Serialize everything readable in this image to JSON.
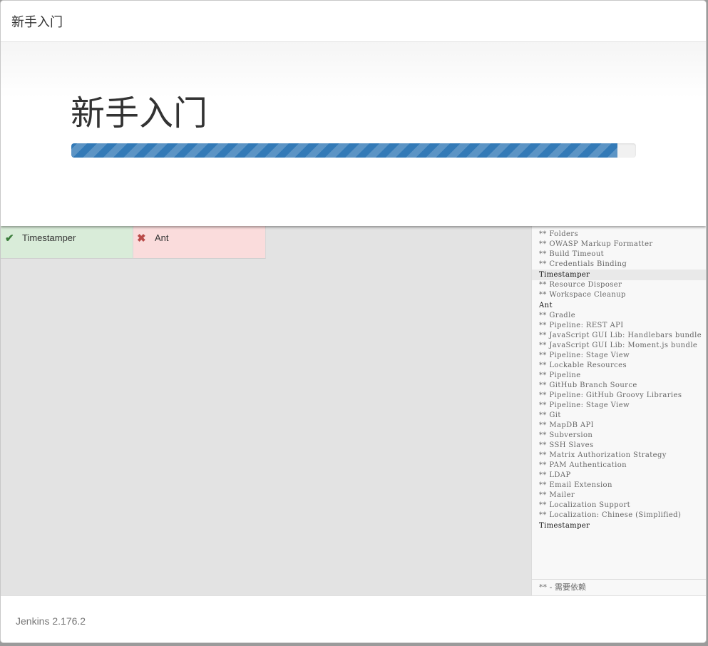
{
  "header": {
    "title": "新手入门"
  },
  "jumbotron": {
    "title": "新手入门",
    "progress_percent": 96.7,
    "progress_color": "#337ab7"
  },
  "plugins": [
    {
      "name": "Timestamper",
      "status": "success",
      "icon": "check-icon"
    },
    {
      "name": "Ant",
      "status": "failed",
      "icon": "cross-icon"
    }
  ],
  "log": {
    "lines": [
      {
        "text": "** Folders",
        "type": "dep"
      },
      {
        "text": "** OWASP Markup Formatter",
        "type": "dep"
      },
      {
        "text": "** Build Timeout",
        "type": "dep"
      },
      {
        "text": "** Credentials Binding",
        "type": "dep"
      },
      {
        "text": "Timestamper",
        "type": "header",
        "highlight": true
      },
      {
        "text": "** Resource Disposer",
        "type": "dep"
      },
      {
        "text": "** Workspace Cleanup",
        "type": "dep"
      },
      {
        "text": "Ant",
        "type": "header"
      },
      {
        "text": "** Gradle",
        "type": "dep"
      },
      {
        "text": "** Pipeline: REST API",
        "type": "dep"
      },
      {
        "text": "** JavaScript GUI Lib: Handlebars bundle",
        "type": "dep"
      },
      {
        "text": "** JavaScript GUI Lib: Moment.js bundle",
        "type": "dep"
      },
      {
        "text": "** Pipeline: Stage View",
        "type": "dep"
      },
      {
        "text": "** Lockable Resources",
        "type": "dep"
      },
      {
        "text": "** Pipeline",
        "type": "dep"
      },
      {
        "text": "** GitHub Branch Source",
        "type": "dep"
      },
      {
        "text": "** Pipeline: GitHub Groovy Libraries",
        "type": "dep"
      },
      {
        "text": "** Pipeline: Stage View",
        "type": "dep"
      },
      {
        "text": "** Git",
        "type": "dep"
      },
      {
        "text": "** MapDB API",
        "type": "dep"
      },
      {
        "text": "** Subversion",
        "type": "dep"
      },
      {
        "text": "** SSH Slaves",
        "type": "dep"
      },
      {
        "text": "** Matrix Authorization Strategy",
        "type": "dep"
      },
      {
        "text": "** PAM Authentication",
        "type": "dep"
      },
      {
        "text": "** LDAP",
        "type": "dep"
      },
      {
        "text": "** Email Extension",
        "type": "dep"
      },
      {
        "text": "** Mailer",
        "type": "dep"
      },
      {
        "text": "** Localization Support",
        "type": "dep"
      },
      {
        "text": "** Localization: Chinese (Simplified)",
        "type": "dep"
      },
      {
        "text": "Timestamper",
        "type": "header"
      }
    ],
    "footer": "** - 需要依赖"
  },
  "footer": {
    "version": "Jenkins 2.176.2"
  }
}
